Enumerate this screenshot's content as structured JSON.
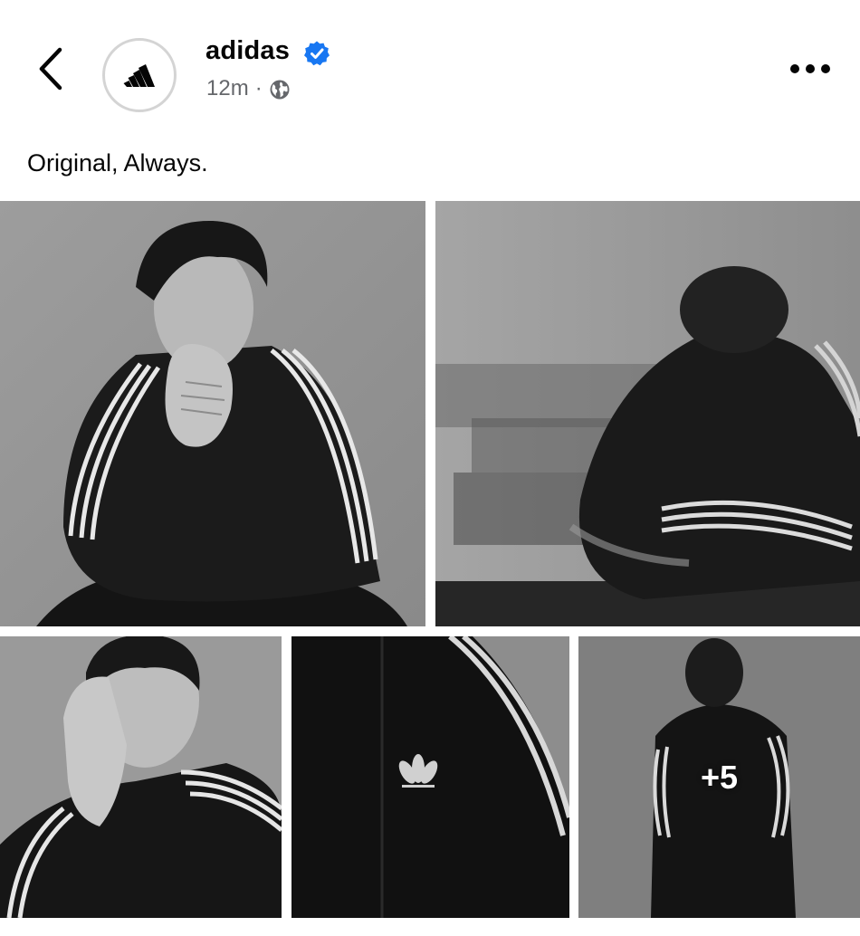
{
  "post": {
    "page_name": "adidas",
    "time": "12m",
    "separator": "·",
    "caption": "Original, Always.",
    "more_count": "+5"
  },
  "icons": {
    "back": "chevron-left-icon",
    "verified": "verified-badge-icon",
    "privacy": "globe-icon",
    "more": "more-horizontal-icon",
    "logo": "adidas-logo",
    "trefoil": "trefoil-logo"
  },
  "colors": {
    "verified_blue": "#1877f2",
    "meta_gray": "#65676b",
    "text": "#050505",
    "background": "#ffffff"
  }
}
